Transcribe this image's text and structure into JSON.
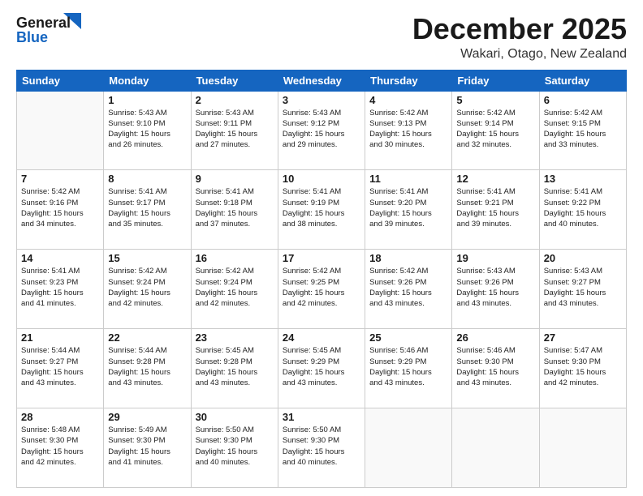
{
  "header": {
    "logo_line1": "General",
    "logo_line2": "Blue",
    "month": "December 2025",
    "location": "Wakari, Otago, New Zealand"
  },
  "days_of_week": [
    "Sunday",
    "Monday",
    "Tuesday",
    "Wednesday",
    "Thursday",
    "Friday",
    "Saturday"
  ],
  "weeks": [
    [
      {
        "day": "",
        "info": ""
      },
      {
        "day": "1",
        "info": "Sunrise: 5:43 AM\nSunset: 9:10 PM\nDaylight: 15 hours\nand 26 minutes."
      },
      {
        "day": "2",
        "info": "Sunrise: 5:43 AM\nSunset: 9:11 PM\nDaylight: 15 hours\nand 27 minutes."
      },
      {
        "day": "3",
        "info": "Sunrise: 5:43 AM\nSunset: 9:12 PM\nDaylight: 15 hours\nand 29 minutes."
      },
      {
        "day": "4",
        "info": "Sunrise: 5:42 AM\nSunset: 9:13 PM\nDaylight: 15 hours\nand 30 minutes."
      },
      {
        "day": "5",
        "info": "Sunrise: 5:42 AM\nSunset: 9:14 PM\nDaylight: 15 hours\nand 32 minutes."
      },
      {
        "day": "6",
        "info": "Sunrise: 5:42 AM\nSunset: 9:15 PM\nDaylight: 15 hours\nand 33 minutes."
      }
    ],
    [
      {
        "day": "7",
        "info": "Sunrise: 5:42 AM\nSunset: 9:16 PM\nDaylight: 15 hours\nand 34 minutes."
      },
      {
        "day": "8",
        "info": "Sunrise: 5:41 AM\nSunset: 9:17 PM\nDaylight: 15 hours\nand 35 minutes."
      },
      {
        "day": "9",
        "info": "Sunrise: 5:41 AM\nSunset: 9:18 PM\nDaylight: 15 hours\nand 37 minutes."
      },
      {
        "day": "10",
        "info": "Sunrise: 5:41 AM\nSunset: 9:19 PM\nDaylight: 15 hours\nand 38 minutes."
      },
      {
        "day": "11",
        "info": "Sunrise: 5:41 AM\nSunset: 9:20 PM\nDaylight: 15 hours\nand 39 minutes."
      },
      {
        "day": "12",
        "info": "Sunrise: 5:41 AM\nSunset: 9:21 PM\nDaylight: 15 hours\nand 39 minutes."
      },
      {
        "day": "13",
        "info": "Sunrise: 5:41 AM\nSunset: 9:22 PM\nDaylight: 15 hours\nand 40 minutes."
      }
    ],
    [
      {
        "day": "14",
        "info": "Sunrise: 5:41 AM\nSunset: 9:23 PM\nDaylight: 15 hours\nand 41 minutes."
      },
      {
        "day": "15",
        "info": "Sunrise: 5:42 AM\nSunset: 9:24 PM\nDaylight: 15 hours\nand 42 minutes."
      },
      {
        "day": "16",
        "info": "Sunrise: 5:42 AM\nSunset: 9:24 PM\nDaylight: 15 hours\nand 42 minutes."
      },
      {
        "day": "17",
        "info": "Sunrise: 5:42 AM\nSunset: 9:25 PM\nDaylight: 15 hours\nand 42 minutes."
      },
      {
        "day": "18",
        "info": "Sunrise: 5:42 AM\nSunset: 9:26 PM\nDaylight: 15 hours\nand 43 minutes."
      },
      {
        "day": "19",
        "info": "Sunrise: 5:43 AM\nSunset: 9:26 PM\nDaylight: 15 hours\nand 43 minutes."
      },
      {
        "day": "20",
        "info": "Sunrise: 5:43 AM\nSunset: 9:27 PM\nDaylight: 15 hours\nand 43 minutes."
      }
    ],
    [
      {
        "day": "21",
        "info": "Sunrise: 5:44 AM\nSunset: 9:27 PM\nDaylight: 15 hours\nand 43 minutes."
      },
      {
        "day": "22",
        "info": "Sunrise: 5:44 AM\nSunset: 9:28 PM\nDaylight: 15 hours\nand 43 minutes."
      },
      {
        "day": "23",
        "info": "Sunrise: 5:45 AM\nSunset: 9:28 PM\nDaylight: 15 hours\nand 43 minutes."
      },
      {
        "day": "24",
        "info": "Sunrise: 5:45 AM\nSunset: 9:29 PM\nDaylight: 15 hours\nand 43 minutes."
      },
      {
        "day": "25",
        "info": "Sunrise: 5:46 AM\nSunset: 9:29 PM\nDaylight: 15 hours\nand 43 minutes."
      },
      {
        "day": "26",
        "info": "Sunrise: 5:46 AM\nSunset: 9:30 PM\nDaylight: 15 hours\nand 43 minutes."
      },
      {
        "day": "27",
        "info": "Sunrise: 5:47 AM\nSunset: 9:30 PM\nDaylight: 15 hours\nand 42 minutes."
      }
    ],
    [
      {
        "day": "28",
        "info": "Sunrise: 5:48 AM\nSunset: 9:30 PM\nDaylight: 15 hours\nand 42 minutes."
      },
      {
        "day": "29",
        "info": "Sunrise: 5:49 AM\nSunset: 9:30 PM\nDaylight: 15 hours\nand 41 minutes."
      },
      {
        "day": "30",
        "info": "Sunrise: 5:50 AM\nSunset: 9:30 PM\nDaylight: 15 hours\nand 40 minutes."
      },
      {
        "day": "31",
        "info": "Sunrise: 5:50 AM\nSunset: 9:30 PM\nDaylight: 15 hours\nand 40 minutes."
      },
      {
        "day": "",
        "info": ""
      },
      {
        "day": "",
        "info": ""
      },
      {
        "day": "",
        "info": ""
      }
    ]
  ]
}
